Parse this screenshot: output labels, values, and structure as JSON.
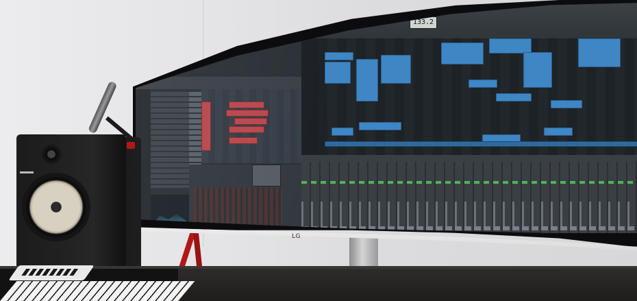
{
  "scene": {
    "monitor_brand": "LG",
    "daw_tempo_display": "133.2"
  },
  "colors": {
    "wall": "#e4e4e6",
    "desk": "#1b1918",
    "accent_red": "#b01818",
    "region_blue": "#3e86c4",
    "clip_red": "#b8474c",
    "meter_green": "#4fb35a"
  }
}
